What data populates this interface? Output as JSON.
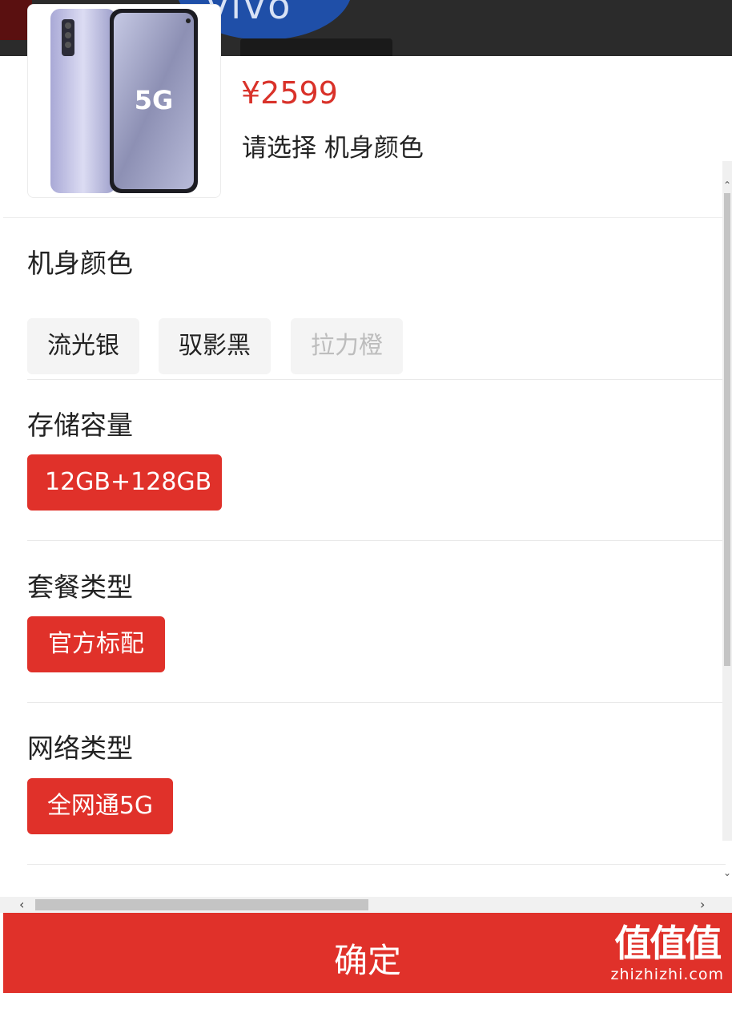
{
  "background": {
    "logo_text": "vivo"
  },
  "product": {
    "price": "¥2599",
    "selection_hint": "请选择 机身颜色",
    "image_badge": "5G"
  },
  "groups": [
    {
      "title": "机身颜色",
      "options": [
        {
          "label": "流光银",
          "state": "normal"
        },
        {
          "label": "驭影黑",
          "state": "normal"
        },
        {
          "label": "拉力橙",
          "state": "disabled"
        }
      ]
    },
    {
      "title": "存储容量",
      "options": [
        {
          "label": "12GB+128GB",
          "state": "selected"
        }
      ]
    },
    {
      "title": "套餐类型",
      "options": [
        {
          "label": "官方标配",
          "state": "selected"
        }
      ]
    },
    {
      "title": "网络类型",
      "options": [
        {
          "label": "全网通5G",
          "state": "selected"
        }
      ]
    }
  ],
  "confirm_label": "确定",
  "scrollbar": {
    "up": "⌃",
    "down": "⌄",
    "left": "‹",
    "right": "›"
  },
  "watermark": {
    "mark": "值值值",
    "url": "zhizhizhi.com"
  },
  "colors": {
    "accent": "#e0312a",
    "price": "#d9322a",
    "chip_bg": "#f4f4f4",
    "disabled_text": "#bdbdbd"
  }
}
